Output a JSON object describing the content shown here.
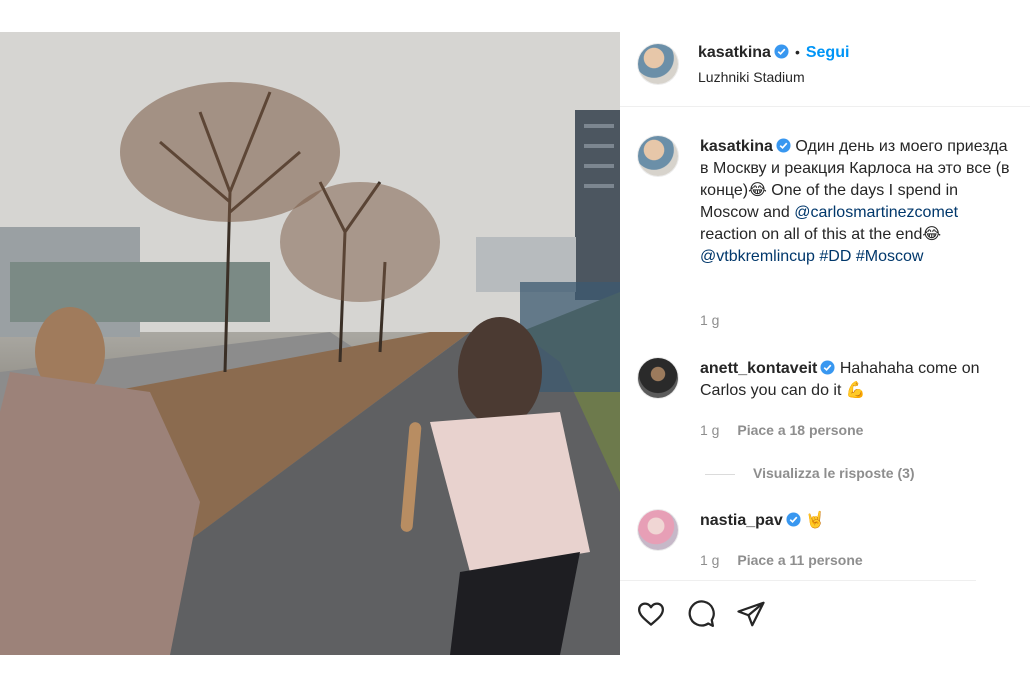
{
  "post": {
    "author": "kasatkina",
    "separator": "•",
    "follow_label": "Segui",
    "location": "Luzhniki Stadium"
  },
  "caption": {
    "author": "kasatkina",
    "text_ru": "Один день из моего приезда в Москву и реакция Карлоса на это все (в конце)😂 One of the days I spend in Moscow and",
    "mention": "@carlosmartinezcomet",
    "text_mid": "reaction on all of this at the end😂",
    "tag1": "@vtbkremlincup",
    "tag2": "#DD",
    "tag3": "#Moscow",
    "time": "1 g"
  },
  "comments": [
    {
      "author": "anett_kontaveit",
      "text": "Hahahaha come on Carlos you can do it 💪",
      "time": "1 g",
      "likes": "Piace a 18 persone",
      "view_replies": "Visualizza le risposte (3)"
    },
    {
      "author": "nastia_pav",
      "text": "🤘",
      "time": "1 g",
      "likes": "Piace a 11 persone"
    }
  ],
  "icons": {
    "verified": "verified-badge-icon",
    "like": "heart-icon",
    "comment": "comment-bubble-icon",
    "share": "paper-plane-icon"
  },
  "colors": {
    "accent": "#0095f6",
    "link": "#00376b",
    "muted": "#8e8e8e",
    "text": "#262626"
  }
}
